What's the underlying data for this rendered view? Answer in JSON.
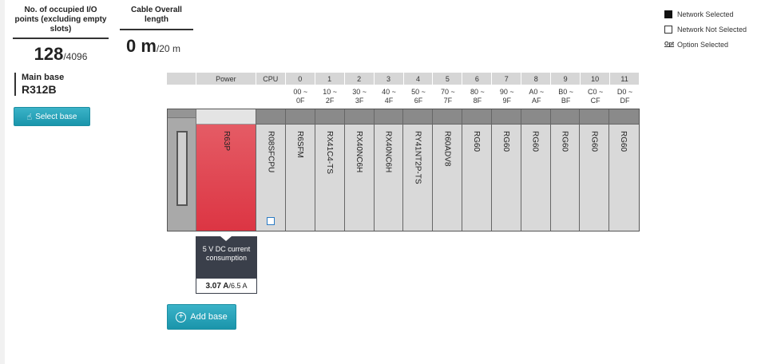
{
  "stats": {
    "io_points_label": "No. of occupied I/O points (excluding empty slots)",
    "io_points_value": "128",
    "io_points_max": "/4096",
    "cable_label": "Cable Overall length",
    "cable_value": "0 m",
    "cable_max": "/20 m"
  },
  "base": {
    "label": "Main base",
    "name": "R312B",
    "select_button": "Select base",
    "add_button": "Add base"
  },
  "legend": {
    "network_selected": "Network Selected",
    "network_not_selected": "Network Not Selected",
    "option_mark": "Opt",
    "option_selected": "Option Selected"
  },
  "rack": {
    "power_header": "Power",
    "cpu_header": "CPU",
    "slot_headers": [
      "0",
      "1",
      "2",
      "3",
      "4",
      "5",
      "6",
      "7",
      "8",
      "9",
      "10",
      "11"
    ],
    "slot_addresses": [
      [
        "00 ~",
        "0F"
      ],
      [
        "10 ~",
        "2F"
      ],
      [
        "30 ~",
        "3F"
      ],
      [
        "40 ~",
        "4F"
      ],
      [
        "50 ~",
        "6F"
      ],
      [
        "70 ~",
        "7F"
      ],
      [
        "80 ~",
        "8F"
      ],
      [
        "90 ~",
        "9F"
      ],
      [
        "A0 ~",
        "AF"
      ],
      [
        "B0 ~",
        "BF"
      ],
      [
        "C0 ~",
        "CF"
      ],
      [
        "D0 ~",
        "DF"
      ]
    ],
    "power_module": "R63P",
    "cpu_module": "R08SFCPU",
    "slot_modules": [
      "R6SFM",
      "RX41C4-TS",
      "RX40NC6H",
      "RX40NC6H",
      "RY41NT2P-TS",
      "R60ADV8",
      "RG60",
      "RG60",
      "RG60",
      "RG60",
      "RG60",
      "RG60"
    ]
  },
  "consumption": {
    "label": "5 V DC current consumption",
    "value": "3.07 A",
    "max": "/6.5 A"
  },
  "colors": {
    "accent": "#1a95ab",
    "power_module": "#dc3543",
    "consumption_header": "#3a3f4a"
  }
}
